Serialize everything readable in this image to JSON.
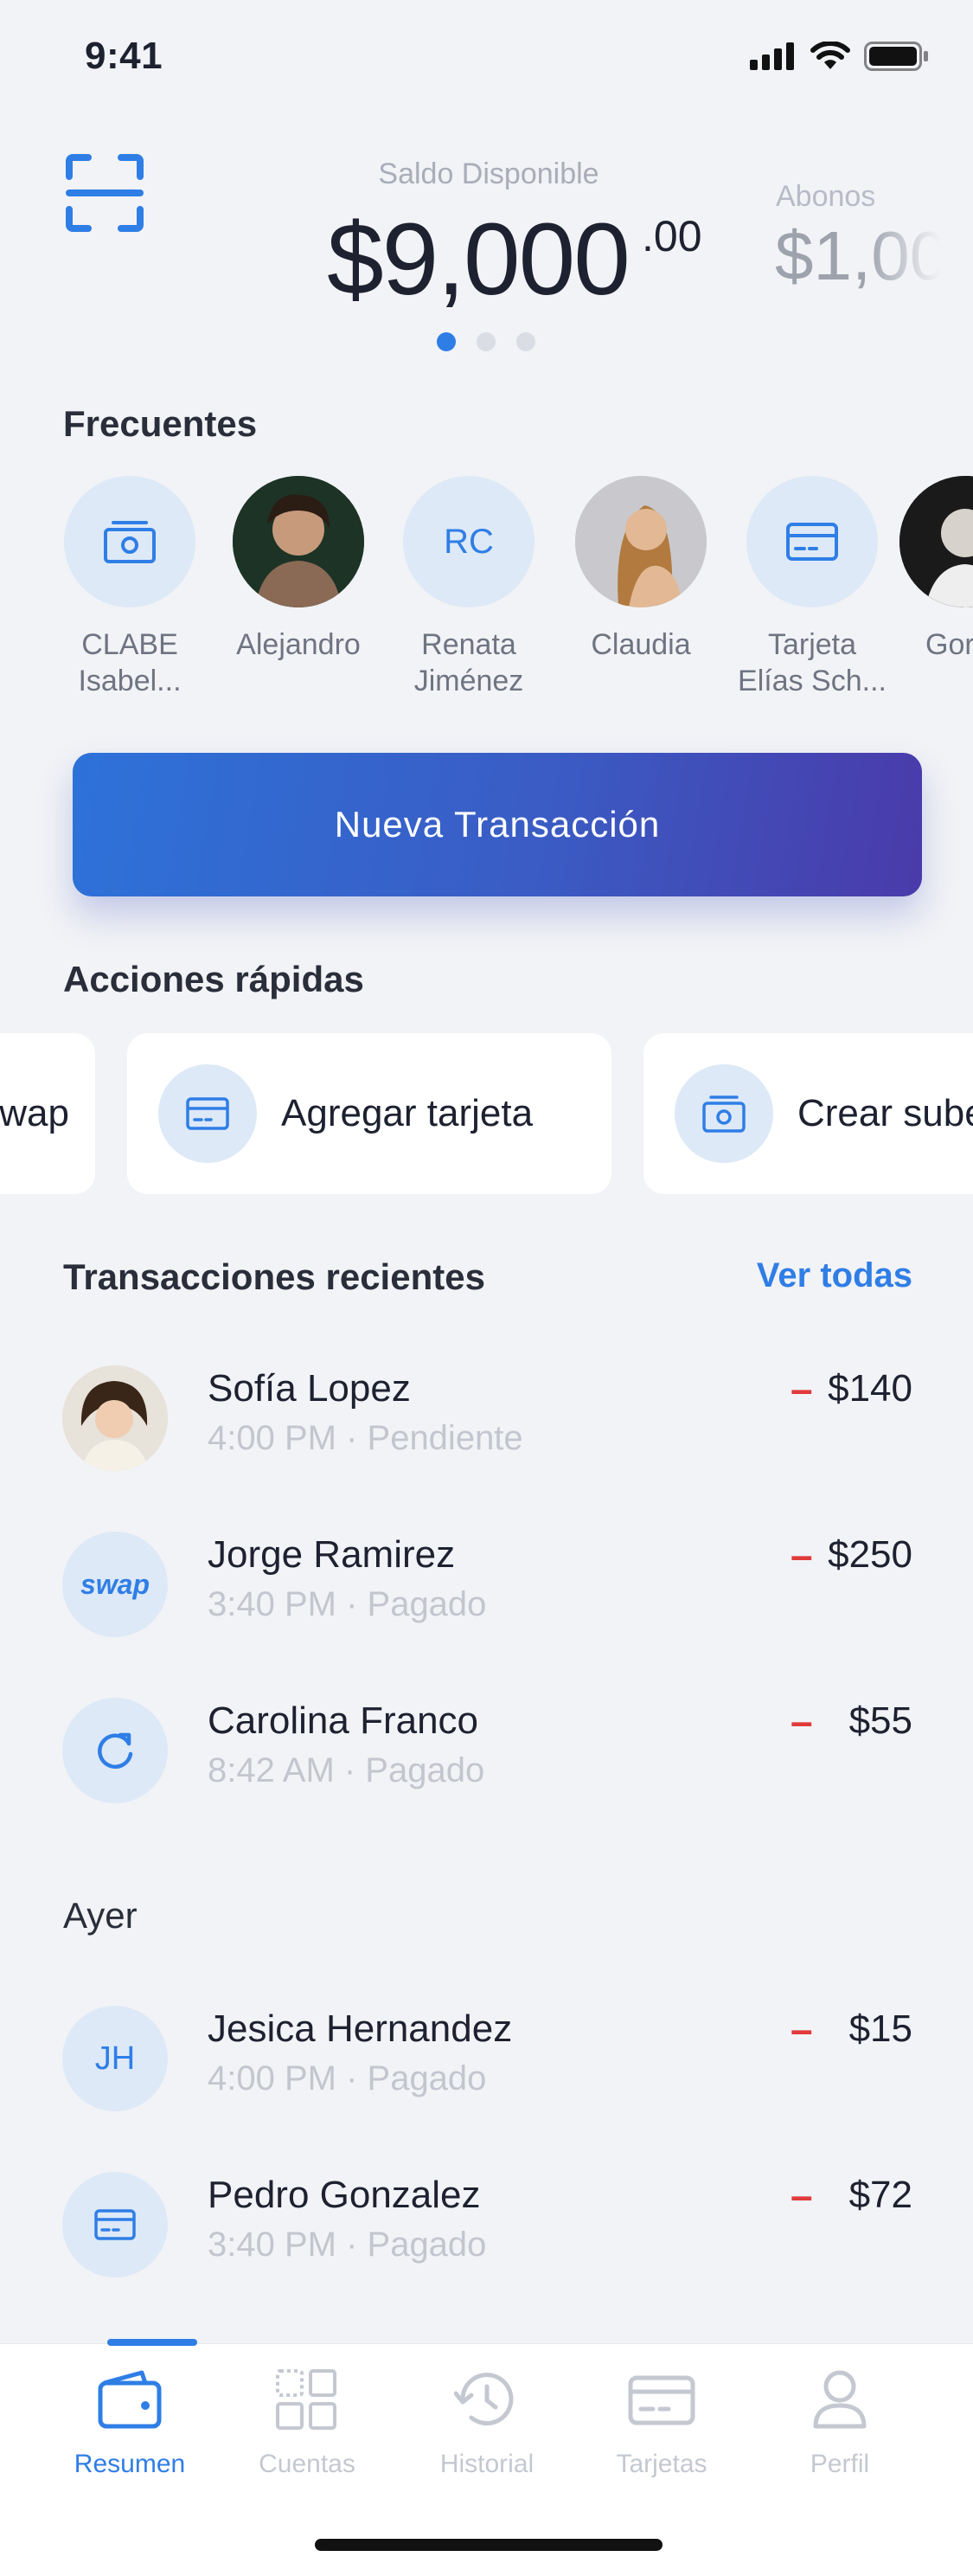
{
  "status_bar": {
    "time": "9:41"
  },
  "balance": {
    "label": "Saldo Disponible",
    "amount": "$9,000",
    "cents": ".00",
    "next_card_label": "Abonos",
    "next_card_amount": "$1,00"
  },
  "frequents": {
    "title": "Frecuentes",
    "items": [
      {
        "label": "CLABE\nIsabel...",
        "icon": "bank-icon"
      },
      {
        "label": "Alejandro",
        "icon": "photo"
      },
      {
        "label": "Renata\nJiménez",
        "initials": "RC"
      },
      {
        "label": "Claudia",
        "icon": "photo"
      },
      {
        "label": "Tarjeta\nElías Sch...",
        "icon": "card-icon"
      },
      {
        "label": "Gor",
        "icon": "photo"
      }
    ]
  },
  "cta": {
    "label": "Nueva Transacción"
  },
  "quick_actions": {
    "title": "Acciones rápidas",
    "items": [
      {
        "label": "wap"
      },
      {
        "label": "Agregar tarjeta",
        "icon": "card-icon"
      },
      {
        "label": "Crear sube",
        "icon": "bank-icon"
      }
    ]
  },
  "recent": {
    "title": "Transacciones recientes",
    "see_all": "Ver todas",
    "items": [
      {
        "name": "Sofía Lopez",
        "meta": "4:00 PM · Pendiente",
        "sign": "–",
        "amount": "$140"
      },
      {
        "name": "Jorge Ramirez",
        "meta": "3:40 PM · Pagado",
        "sign": "–",
        "amount": "$250",
        "avatar_text": "swap"
      },
      {
        "name": "Carolina Franco",
        "meta": "8:42 AM · Pagado",
        "sign": "–",
        "amount": "$55"
      }
    ]
  },
  "yesterday": {
    "title": "Ayer",
    "items": [
      {
        "name": "Jesica Hernandez",
        "meta": "4:00 PM · Pagado",
        "sign": "–",
        "amount": "$15",
        "initials": "JH"
      },
      {
        "name": "Pedro Gonzalez",
        "meta": "3:40 PM · Pagado",
        "sign": "–",
        "amount": "$72"
      }
    ]
  },
  "tabbar": {
    "items": [
      {
        "label": "Resumen",
        "active": true
      },
      {
        "label": "Cuentas"
      },
      {
        "label": "Historial"
      },
      {
        "label": "Tarjetas"
      },
      {
        "label": "Perfil"
      }
    ]
  },
  "colors": {
    "accent": "#2f7ee6",
    "negative": "#e03a3a",
    "background": "#f2f3f6"
  }
}
